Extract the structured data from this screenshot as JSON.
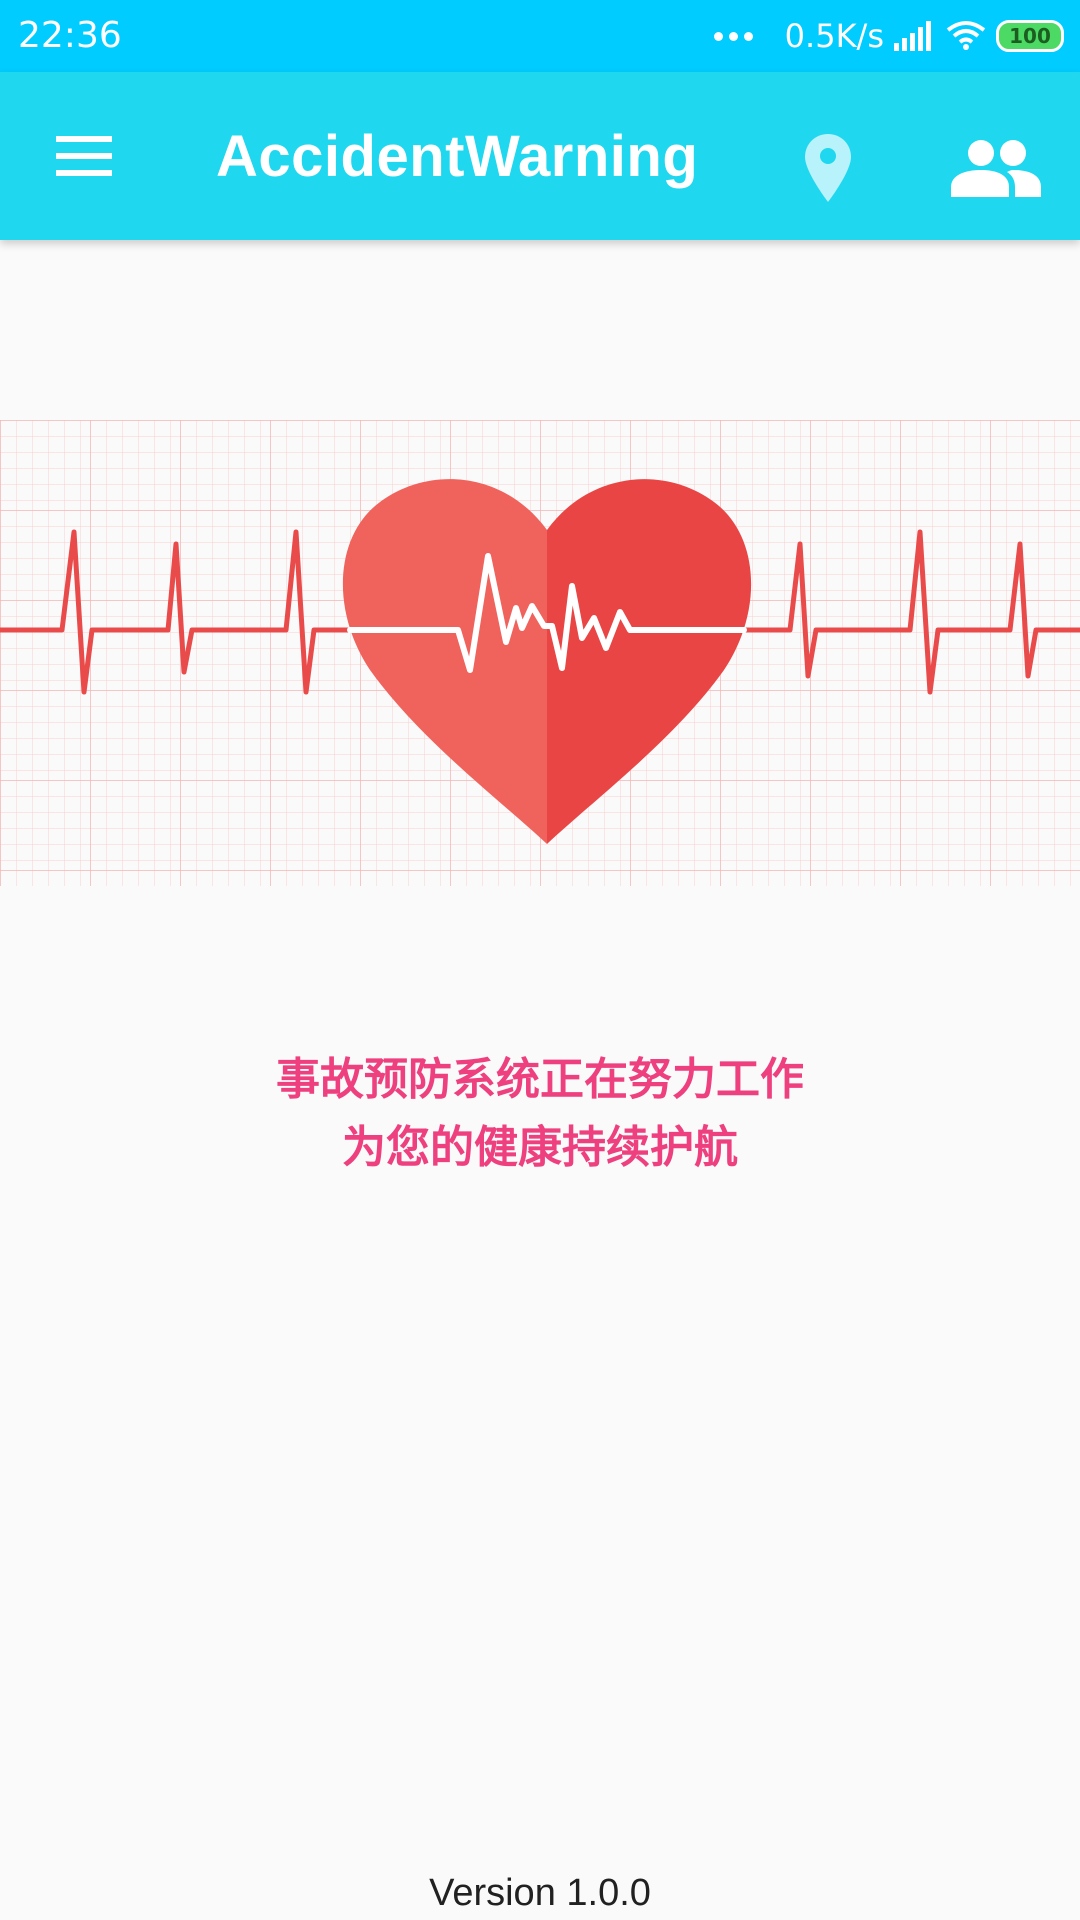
{
  "status_bar": {
    "time": "22:36",
    "network_speed": "0.5K/s",
    "battery_level": "100",
    "icons": [
      "more-dots-icon",
      "signal-icon",
      "wifi-icon",
      "battery-icon"
    ]
  },
  "app_bar": {
    "title": "AccidentWarning",
    "icons": [
      "menu-icon",
      "location-pin-icon",
      "people-icon"
    ]
  },
  "hero": {
    "icon": "heartbeat-heart-icon"
  },
  "tagline": {
    "line1": "事故预防系统正在努力工作",
    "line2": "为您的健康持续护航"
  },
  "footer": {
    "version": "Version 1.0.0"
  },
  "colors": {
    "status_bar": "#00CCFF",
    "app_bar": "#1FD7EE",
    "heart_left": "#F0625C",
    "heart_right": "#E94545",
    "ecg_line": "#E94B4B",
    "tagline": "#EE3F7F",
    "background": "#FAFAFA"
  }
}
